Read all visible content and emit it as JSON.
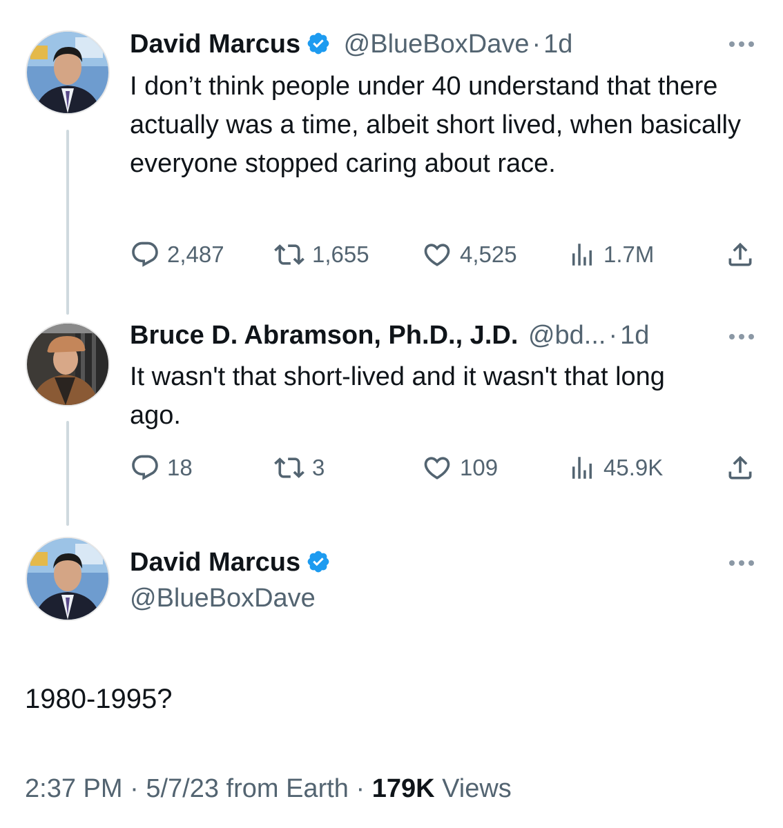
{
  "tweet1": {
    "name": "David Marcus",
    "handle": "@BlueBoxDave",
    "separator": "·",
    "time": "1d",
    "text": "I don’t think people under 40 understand that there actually was a time, albeit short lived, when basically everyone stopped caring about race.",
    "replies": "2,487",
    "retweets": "1,655",
    "likes": "4,525",
    "views": "1.7M"
  },
  "tweet2": {
    "name": "Bruce D. Abramson, Ph.D., J.D.",
    "handle": "@bd...",
    "separator": "·",
    "time": "1d",
    "text": "It wasn't that short-lived and it wasn't that long ago.",
    "replies": "18",
    "retweets": "3",
    "likes": "109",
    "views": "45.9K"
  },
  "main_tweet": {
    "name": "David Marcus",
    "handle": "@BlueBoxDave",
    "text": "1980-1995?",
    "time": "2:37 PM",
    "separator": "·",
    "date": "5/7/23",
    "source": "from Earth",
    "views_count": "179K",
    "views_label": "Views"
  },
  "icons": {
    "verified": "verified-badge-icon",
    "more": "more-dots-icon",
    "reply": "reply-bubble-icon",
    "retweet": "retweet-icon",
    "like": "heart-icon",
    "views": "views-bar-chart-icon",
    "share": "share-icon"
  },
  "colors": {
    "text": "#0f1419",
    "secondary": "#536471",
    "verified": "#1d9bf0",
    "thread_line": "#cfd9de"
  }
}
